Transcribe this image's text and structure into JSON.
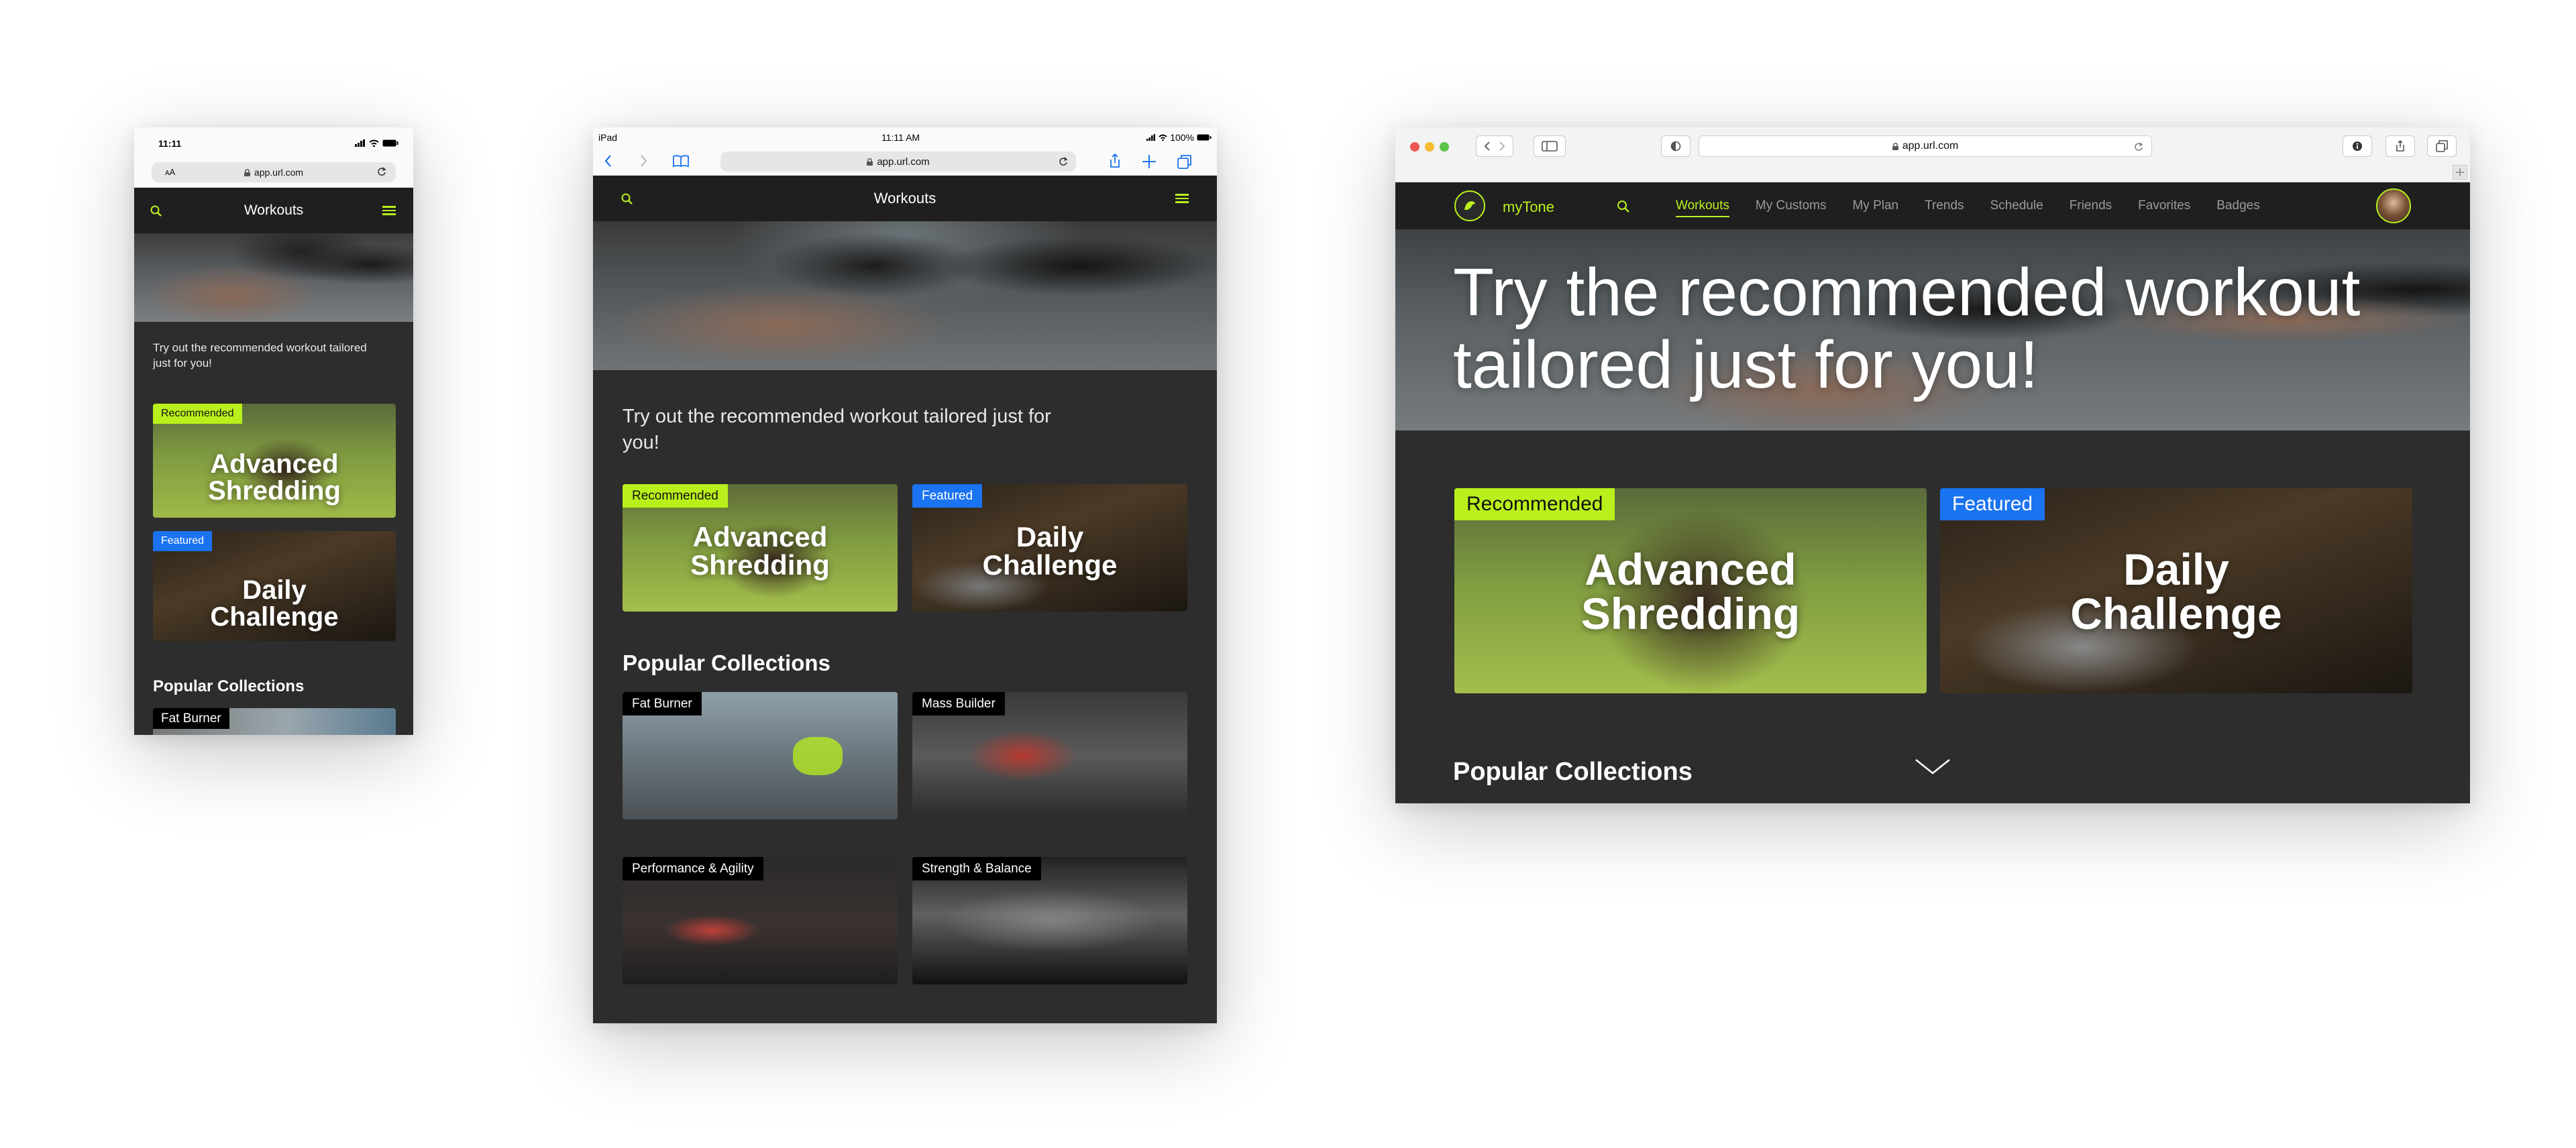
{
  "colors": {
    "accent": "#b9f01b",
    "featured": "#1a73f0",
    "panel": "#2d2d2d",
    "nav": "#1f1f1f"
  },
  "phone": {
    "status": {
      "time": "11:11"
    },
    "url_bar": {
      "text_size": "ᴀA",
      "url": "app.url.com"
    },
    "nav": {
      "title": "Workouts"
    },
    "intro": "Try out the recommended workout tailored just for you!",
    "cards": [
      {
        "badge": "Recommended",
        "title_line1": "Advanced",
        "title_line2": "Shredding"
      },
      {
        "badge": "Featured",
        "title_line1": "Daily",
        "title_line2": "Challenge"
      }
    ],
    "section_title": "Popular Collections",
    "collections": [
      {
        "label": "Fat Burner"
      }
    ]
  },
  "tablet": {
    "status": {
      "device": "iPad",
      "time": "11:11 AM",
      "battery": "100%"
    },
    "url_bar": {
      "url": "app.url.com"
    },
    "nav": {
      "title": "Workouts"
    },
    "intro": "Try out the recommended workout tailored just for you!",
    "cards": [
      {
        "badge": "Recommended",
        "title_line1": "Advanced",
        "title_line2": "Shredding"
      },
      {
        "badge": "Featured",
        "title_line1": "Daily",
        "title_line2": "Challenge"
      }
    ],
    "section_title": "Popular Collections",
    "collections": [
      {
        "label": "Fat Burner"
      },
      {
        "label": "Mass Builder"
      },
      {
        "label": "Performance & Agility"
      },
      {
        "label": "Strength & Balance"
      }
    ]
  },
  "desktop": {
    "url_bar": {
      "url": "app.url.com"
    },
    "brand": "myTone",
    "nav_items": [
      "Workouts",
      "My Customs",
      "My Plan",
      "Trends",
      "Schedule",
      "Friends",
      "Favorites",
      "Badges"
    ],
    "active_nav": "Workouts",
    "hero_line1": "Try the recommended workout",
    "hero_line2": "tailored just for you!",
    "cards": [
      {
        "badge": "Recommended",
        "title_line1": "Advanced",
        "title_line2": "Shredding"
      },
      {
        "badge": "Featured",
        "title_line1": "Daily",
        "title_line2": "Challenge"
      }
    ],
    "section_title": "Popular Collections"
  }
}
